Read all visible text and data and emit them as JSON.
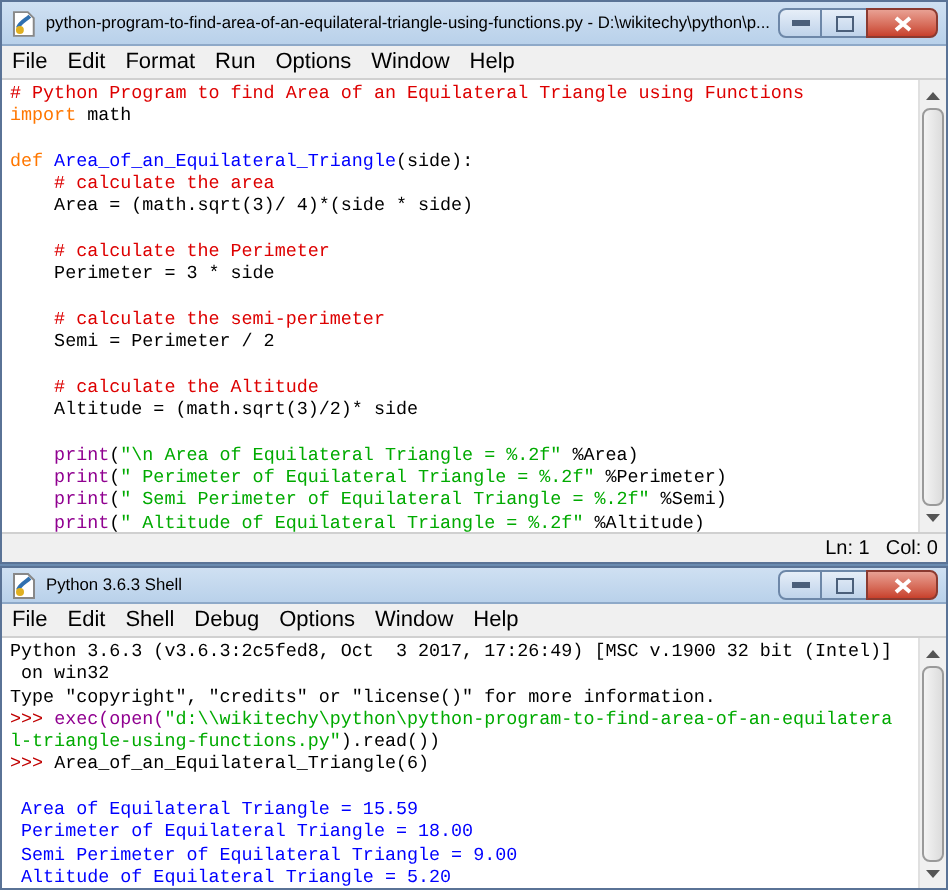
{
  "editor": {
    "title": "python-program-to-find-area-of-an-equilateral-triangle-using-functions.py - D:\\wikitechy\\python\\p...",
    "menu": [
      "File",
      "Edit",
      "Format",
      "Run",
      "Options",
      "Window",
      "Help"
    ],
    "lines": [
      {
        "kind": "code",
        "tokens": [
          {
            "t": "# Python Program to find Area of an Equilateral Triangle using Functions",
            "kind": "comment"
          }
        ]
      },
      {
        "kind": "code",
        "tokens": [
          {
            "t": "import",
            "kind": "keyword"
          },
          {
            "t": " math",
            "kind": "plain"
          }
        ]
      },
      {
        "kind": "blank"
      },
      {
        "kind": "code",
        "tokens": [
          {
            "t": "def",
            "kind": "keyword"
          },
          {
            "t": " Area_of_an_Equilateral_Triangle",
            "kind": "defname"
          },
          {
            "t": "(side):",
            "kind": "plain"
          }
        ]
      },
      {
        "kind": "code",
        "tokens": [
          {
            "t": "    # calculate the area",
            "kind": "comment"
          }
        ]
      },
      {
        "kind": "code",
        "tokens": [
          {
            "t": "    Area = (math.sqrt(3)/ 4)*(side * side)",
            "kind": "plain"
          }
        ]
      },
      {
        "kind": "blank"
      },
      {
        "kind": "code",
        "tokens": [
          {
            "t": "    # calculate the Perimeter",
            "kind": "comment"
          }
        ]
      },
      {
        "kind": "code",
        "tokens": [
          {
            "t": "    Perimeter = 3 * side",
            "kind": "plain"
          }
        ]
      },
      {
        "kind": "blank"
      },
      {
        "kind": "code",
        "tokens": [
          {
            "t": "    # calculate the semi-perimeter",
            "kind": "comment"
          }
        ]
      },
      {
        "kind": "code",
        "tokens": [
          {
            "t": "    Semi = Perimeter / 2",
            "kind": "plain"
          }
        ]
      },
      {
        "kind": "blank"
      },
      {
        "kind": "code",
        "tokens": [
          {
            "t": "    # calculate the Altitude",
            "kind": "comment"
          }
        ]
      },
      {
        "kind": "code",
        "tokens": [
          {
            "t": "    Altitude = (math.sqrt(3)/2)* side",
            "kind": "plain"
          }
        ]
      },
      {
        "kind": "blank"
      },
      {
        "kind": "code",
        "tokens": [
          {
            "t": "    print",
            "kind": "builtin"
          },
          {
            "t": "(",
            "kind": "plain"
          },
          {
            "t": "\"\\n Area of Equilateral Triangle = %.2f\"",
            "kind": "string"
          },
          {
            "t": " %Area)",
            "kind": "plain"
          }
        ]
      },
      {
        "kind": "code",
        "tokens": [
          {
            "t": "    print",
            "kind": "builtin"
          },
          {
            "t": "(",
            "kind": "plain"
          },
          {
            "t": "\" Perimeter of Equilateral Triangle = %.2f\"",
            "kind": "string"
          },
          {
            "t": " %Perimeter)",
            "kind": "plain"
          }
        ]
      },
      {
        "kind": "code",
        "tokens": [
          {
            "t": "    print",
            "kind": "builtin"
          },
          {
            "t": "(",
            "kind": "plain"
          },
          {
            "t": "\" Semi Perimeter of Equilateral Triangle = %.2f\"",
            "kind": "string"
          },
          {
            "t": " %Semi)",
            "kind": "plain"
          }
        ]
      },
      {
        "kind": "code",
        "tokens": [
          {
            "t": "    print",
            "kind": "builtin"
          },
          {
            "t": "(",
            "kind": "plain"
          },
          {
            "t": "\" Altitude of Equilateral Triangle = %.2f\"",
            "kind": "string"
          },
          {
            "t": " %Altitude)",
            "kind": "plain"
          }
        ]
      }
    ],
    "status": [
      "Ln: 1",
      "Col: 0"
    ]
  },
  "shell": {
    "title": "Python 3.6.3 Shell",
    "menu": [
      "File",
      "Edit",
      "Shell",
      "Debug",
      "Options",
      "Window",
      "Help"
    ],
    "lines": [
      {
        "kind": "code",
        "tokens": [
          {
            "t": "Python 3.6.3 (v3.6.3:2c5fed8, Oct  3 2017, 17:26:49) [MSC v.1900 32 bit (Intel)]",
            "kind": "plain"
          }
        ]
      },
      {
        "kind": "code",
        "tokens": [
          {
            "t": " on win32",
            "kind": "plain"
          }
        ]
      },
      {
        "kind": "code",
        "tokens": [
          {
            "t": "Type \"copyright\", \"credits\" or \"license()\" for more information.",
            "kind": "plain"
          }
        ]
      },
      {
        "kind": "code",
        "tokens": [
          {
            "t": ">>> ",
            "kind": "prompt"
          },
          {
            "t": "exec(open(",
            "kind": "builtin"
          },
          {
            "t": "\"d:\\\\wikitechy\\python\\python-program-to-find-area-of-an-equilatera",
            "kind": "string"
          }
        ]
      },
      {
        "kind": "code",
        "tokens": [
          {
            "t": "l-triangle-using-functions.py\"",
            "kind": "string"
          },
          {
            "t": ").read())",
            "kind": "plain"
          }
        ]
      },
      {
        "kind": "code",
        "tokens": [
          {
            "t": ">>> ",
            "kind": "prompt"
          },
          {
            "t": "Area_of_an_Equilateral_Triangle(6)",
            "kind": "plain"
          }
        ]
      },
      {
        "kind": "blank"
      },
      {
        "kind": "code",
        "tokens": [
          {
            "t": " Area of Equilateral Triangle = 15.59",
            "kind": "output"
          }
        ]
      },
      {
        "kind": "code",
        "tokens": [
          {
            "t": " Perimeter of Equilateral Triangle = 18.00",
            "kind": "output"
          }
        ]
      },
      {
        "kind": "code",
        "tokens": [
          {
            "t": " Semi Perimeter of Equilateral Triangle = 9.00",
            "kind": "output"
          }
        ]
      },
      {
        "kind": "code",
        "tokens": [
          {
            "t": " Altitude of Equilateral Triangle = 5.20",
            "kind": "output"
          }
        ]
      }
    ]
  }
}
